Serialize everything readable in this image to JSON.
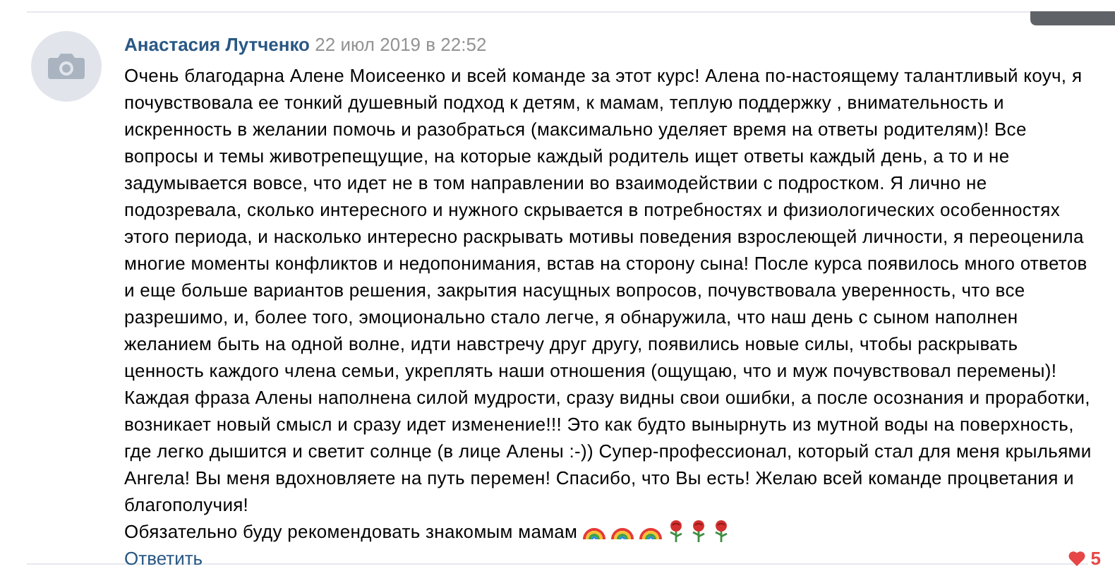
{
  "comment": {
    "author": "Анастасия Лутченко",
    "date": "22 июл 2019 в 22:52",
    "text": "Очень благодарна Алене Моисеенко и всей команде за этот курс! Алена по-настоящему талантливый коуч, я почувствовала ее тонкий душевный подход к детям, к мамам, теплую поддержку , внимательность и искренность в желании помочь и разобраться (максимально уделяет время на ответы родителям)! Все вопросы и темы животрепещущие, на которые каждый родитель ищет ответы каждый день, а то и не задумывается вовсе, что идет не в том направлении во взаимодействии с подростком. Я лично не подозревала, сколько интересного и нужного скрывается в потребностях и физиологических особенностях этого периода, и насколько интересно раскрывать мотивы поведения взрослеющей личности, я переоценила многие моменты конфликтов и недопонимания, встав на сторону сына! После курса появилось много ответов и еще больше вариантов решения, закрытия насущных вопросов, почувствовала уверенность, что все разрешимо, и, более того, эмоционально стало легче, я обнаружила, что наш день с сыном наполнен желанием быть на одной волне, идти навстречу друг другу, появились новые силы, чтобы раскрывать ценность каждого члена семьи, укреплять наши отношения (ощущаю, что и муж почувствовал перемены)! Каждая фраза Алены наполнена силой мудрости, сразу видны свои ошибки, а после осознания и проработки, возникает новый смысл и сразу идет изменение!!! Это как будто вынырнуть из мутной воды на поверхность, где легко дышится и светит солнце (в лице Алены :-)) Супер-профессионал, который стал для меня крыльями Ангела! Вы меня вдохновляете на путь перемен! Спасибо, что Вы есть! Желаю всей команде процветания и благополучия!",
    "closing": "Обязательно буду рекомендовать знакомым мамам",
    "emojis": [
      {
        "kind": "rainbow"
      },
      {
        "kind": "rainbow"
      },
      {
        "kind": "rainbow"
      },
      {
        "kind": "rose"
      },
      {
        "kind": "rose"
      },
      {
        "kind": "rose"
      }
    ],
    "reply": "Ответить",
    "likes": "5",
    "liked": true
  }
}
